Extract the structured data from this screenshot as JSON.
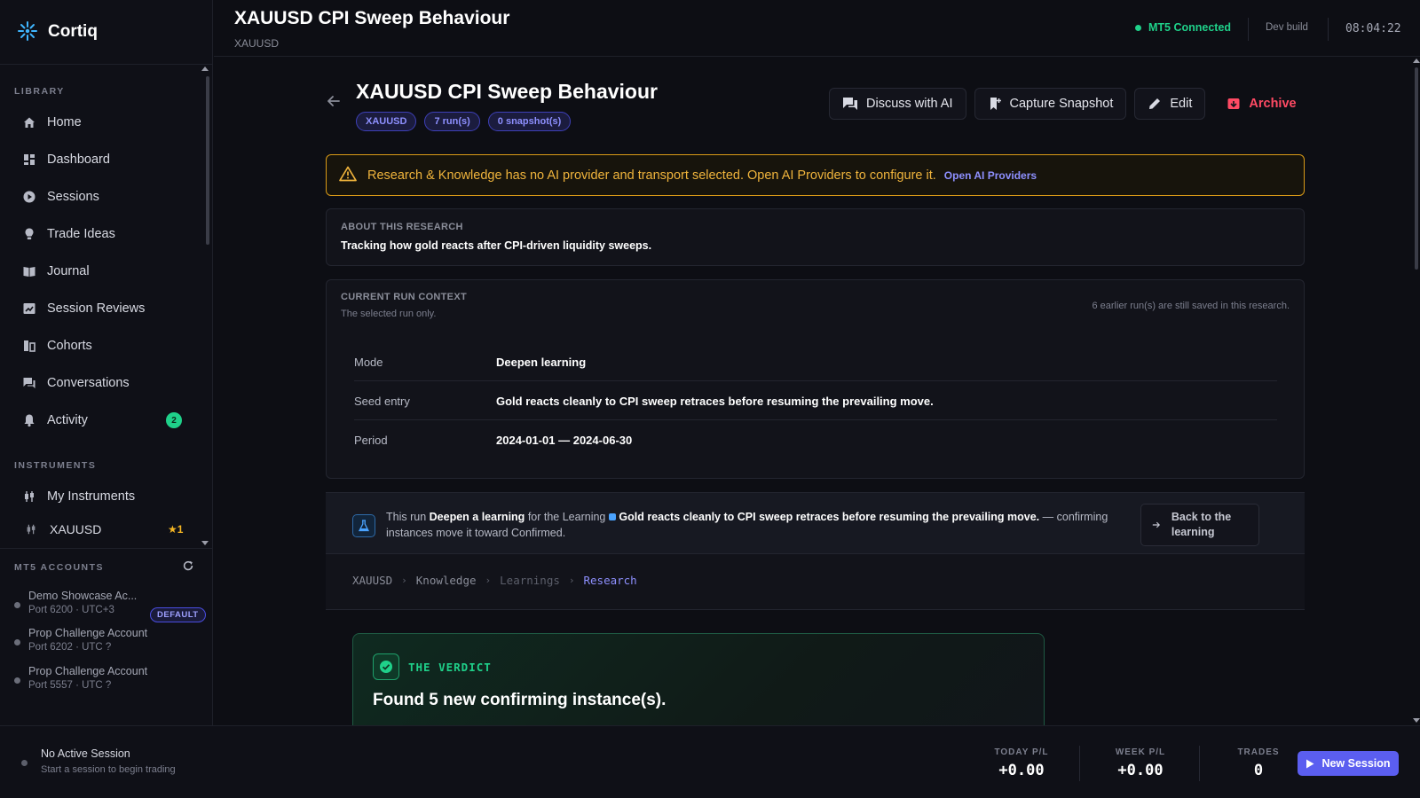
{
  "app": {
    "name": "Cortiq"
  },
  "sidebar": {
    "library_label": "LIBRARY",
    "items": [
      {
        "label": "Home",
        "icon": "home-icon"
      },
      {
        "label": "Dashboard",
        "icon": "dashboard-icon"
      },
      {
        "label": "Sessions",
        "icon": "play-circle-icon"
      },
      {
        "label": "Trade Ideas",
        "icon": "lightbulb-icon"
      },
      {
        "label": "Journal",
        "icon": "book-icon"
      },
      {
        "label": "Session Reviews",
        "icon": "review-icon"
      },
      {
        "label": "Cohorts",
        "icon": "cohorts-icon"
      },
      {
        "label": "Conversations",
        "icon": "chat-icon"
      },
      {
        "label": "Activity",
        "icon": "bell-icon",
        "badge": "2"
      }
    ],
    "instruments_label": "INSTRUMENTS",
    "my_instruments": "My Instruments",
    "instrument": {
      "symbol": "XAUUSD",
      "star": "★1"
    },
    "mt5_label": "MT5 ACCOUNTS",
    "accounts": [
      {
        "name": "Demo Showcase Ac...",
        "sub": "Port 6200 · UTC+3",
        "default": "DEFAULT"
      },
      {
        "name": "Prop Challenge Account",
        "sub": "Port 6202 · UTC ?"
      },
      {
        "name": "Prop Challenge Account",
        "sub": "Port 5557 · UTC ?"
      }
    ]
  },
  "header": {
    "title": "XAUUSD CPI Sweep Behaviour",
    "subtitle": "XAUUSD",
    "mt5_status": "MT5 Connected",
    "build": "Dev build",
    "clock": "08:04:22"
  },
  "page": {
    "title": "XAUUSD CPI Sweep Behaviour",
    "tags": [
      "XAUUSD",
      "7 run(s)",
      "0 snapshot(s)"
    ],
    "actions": {
      "discuss": "Discuss with AI",
      "snapshot": "Capture Snapshot",
      "edit": "Edit",
      "archive": "Archive"
    },
    "warning": {
      "text": "Research & Knowledge has no AI provider and transport selected. Open AI Providers to configure it.",
      "link": "Open AI Providers"
    },
    "about": {
      "label": "ABOUT THIS RESEARCH",
      "text": "Tracking how gold reacts after CPI-driven liquidity sweeps."
    },
    "context": {
      "label": "CURRENT RUN CONTEXT",
      "sub": "The selected run only.",
      "right": "6 earlier run(s) are still saved in this research.",
      "rows": [
        {
          "key": "Mode",
          "value": "Deepen learning"
        },
        {
          "key": "Seed entry",
          "value": "Gold reacts cleanly to CPI sweep retraces before resuming the prevailing move."
        },
        {
          "key": "Period",
          "value": "2024-01-01 — 2024-06-30"
        }
      ]
    },
    "learning_strip": {
      "prefix": "This run",
      "action": "Deepen a learning",
      "middle": "for the Learning",
      "learning": "Gold reacts cleanly to CPI sweep retraces before resuming the prevailing move.",
      "suffix": "— confirming instances move it toward Confirmed.",
      "back_label": "Back to the learning"
    },
    "breadcrumb": [
      "XAUUSD",
      "Knowledge",
      "Learnings",
      "Research"
    ],
    "verdict": {
      "label": "THE VERDICT",
      "title": "Found 5 new confirming instance(s)."
    }
  },
  "footer": {
    "session_title": "No Active Session",
    "session_sub": "Start a session to begin trading",
    "today_label": "TODAY P/L",
    "today_value": "+0.00",
    "week_label": "WEEK P/L",
    "week_value": "+0.00",
    "trades_label": "TRADES",
    "trades_value": "0",
    "new_session": "New Session"
  },
  "colors": {
    "accent": "#5b5ef0",
    "success": "#1fd18a",
    "warning": "#f0b43c",
    "danger": "#ff4a64"
  }
}
